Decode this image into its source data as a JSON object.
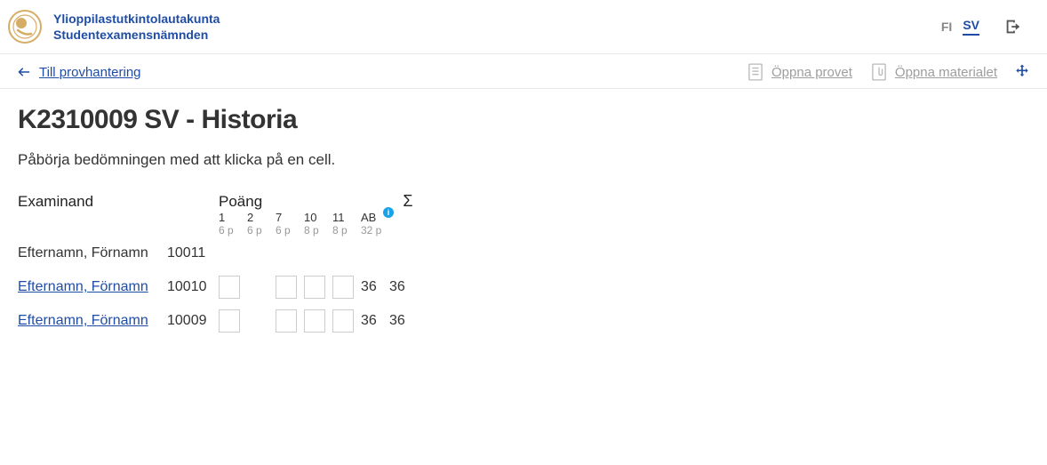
{
  "header": {
    "org_line1": "Ylioppilastutkintolautakunta",
    "org_line2": "Studentexamensnämnden",
    "lang": {
      "fi": "FI",
      "sv": "SV",
      "active": "sv"
    }
  },
  "toolbar": {
    "back_label": "Till provhantering",
    "open_test_label": "Öppna provet",
    "open_material_label": "Öppna materialet"
  },
  "page": {
    "title": "K2310009 SV - Historia",
    "subtitle": "Påbörja bedömningen med att klicka på en cell."
  },
  "table": {
    "head": {
      "examinand": "Examinand",
      "points": "Poäng",
      "sum": "Σ"
    },
    "questions": [
      {
        "label": "1",
        "max": "6 p"
      },
      {
        "label": "2",
        "max": "6 p"
      },
      {
        "label": "7",
        "max": "6 p"
      },
      {
        "label": "10",
        "max": "8 p"
      },
      {
        "label": "11",
        "max": "8 p"
      }
    ],
    "ab": {
      "label": "AB",
      "max": "32 p"
    },
    "rows": [
      {
        "name": "Efternamn, Förnamn",
        "id": "10011",
        "link": false,
        "scores": [
          null,
          null,
          null,
          null,
          null
        ],
        "editable": [
          false,
          false,
          false,
          false,
          false
        ],
        "ab": "",
        "sum": ""
      },
      {
        "name": "Efternamn, Förnamn",
        "id": "10010",
        "link": true,
        "scores": [
          "",
          null,
          "",
          "",
          ""
        ],
        "editable": [
          true,
          false,
          true,
          true,
          true
        ],
        "ab": "36",
        "sum": "36"
      },
      {
        "name": "Efternamn, Förnamn",
        "id": "10009",
        "link": true,
        "scores": [
          "",
          null,
          "",
          "",
          ""
        ],
        "editable": [
          true,
          false,
          true,
          true,
          true
        ],
        "ab": "36",
        "sum": "36"
      }
    ]
  }
}
